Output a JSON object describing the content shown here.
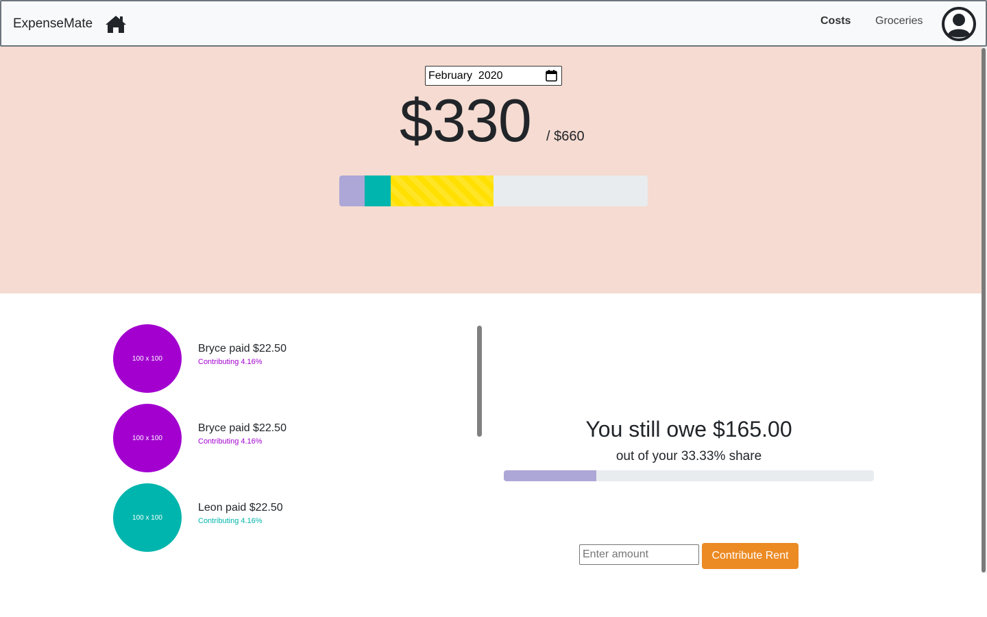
{
  "navbar": {
    "brand": "ExpenseMate",
    "links": [
      {
        "label": "Costs",
        "active": true
      },
      {
        "label": "Groceries",
        "active": false
      }
    ],
    "icons": [
      "home-icon",
      "user-avatar-icon"
    ]
  },
  "hero": {
    "month_value": "February  2020",
    "paid_amount": "$330",
    "total_amount": "/ $660",
    "breakdown": [
      {
        "percent": 8.33,
        "color": "#ada7d7",
        "striped": false
      },
      {
        "percent": 8.33,
        "color": "#00b5ad",
        "striped": false
      },
      {
        "percent": 33.33,
        "color": "#ffe000",
        "striped": true
      }
    ]
  },
  "payments": [
    {
      "avatar_text": "100 x 100",
      "text": "Bryce paid $22.50",
      "contribution": "Contributing 4.16%",
      "color": "#a300d0"
    },
    {
      "avatar_text": "100 x 100",
      "text": "Bryce paid $22.50",
      "contribution": "Contributing 4.16%",
      "color": "#a300d0"
    },
    {
      "avatar_text": "100 x 100",
      "text": "Leon paid $22.50",
      "contribution": "Contributing 4.16%",
      "color": "#00b5ad"
    }
  ],
  "owe": {
    "title": "You still owe $165.00",
    "subtitle": "out of your 33.33% share",
    "progress_percent": 25
  },
  "contribute": {
    "placeholder": "Enter amount",
    "button_label": "Contribute Rent"
  }
}
